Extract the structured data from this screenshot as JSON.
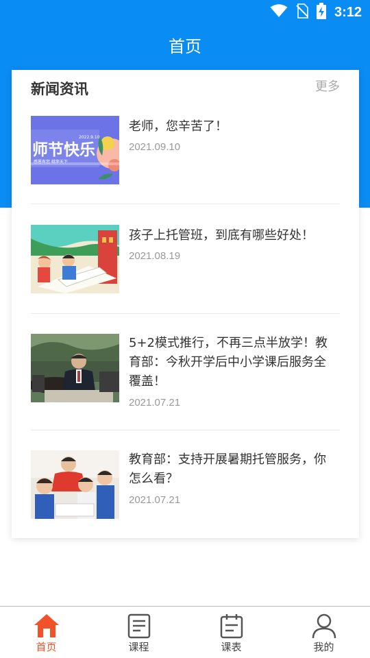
{
  "status_bar": {
    "time": "3:12",
    "icons": [
      "wifi-icon",
      "no-sim-icon",
      "battery-charging-icon"
    ]
  },
  "header": {
    "title": "首页",
    "background_color": "#0a8cf5"
  },
  "news_section": {
    "title": "新闻资讯",
    "more_label": "更多",
    "items": [
      {
        "title": "老师，您辛苦了！",
        "date": "2021.09.10",
        "image": "teachers-day-banner"
      },
      {
        "title": "孩子上托管班，到底有哪些好处！",
        "date": "2021.08.19",
        "image": "children-reading-illustration"
      },
      {
        "title": "5+2模式推行，不再三点半放学！教育部：今秋开学后中小学课后服务全覆盖！",
        "date": "2021.07.21",
        "image": "meeting-photo"
      },
      {
        "title": "教育部：支持开展暑期托管服务，你怎么看？",
        "date": "2021.07.21",
        "image": "teacher-with-children-photo"
      }
    ],
    "thumb_texts": {
      "banner_big": "师节快乐",
      "banner_date": "2022.9.10",
      "banner_small": "感恩有您 桃李天下"
    }
  },
  "bottom_nav": {
    "active_color": "#f0522a",
    "items": [
      {
        "label": "首页",
        "icon": "home-icon",
        "active": true
      },
      {
        "label": "课程",
        "icon": "course-icon",
        "active": false
      },
      {
        "label": "课表",
        "icon": "schedule-icon",
        "active": false
      },
      {
        "label": "我的",
        "icon": "profile-icon",
        "active": false
      }
    ]
  }
}
